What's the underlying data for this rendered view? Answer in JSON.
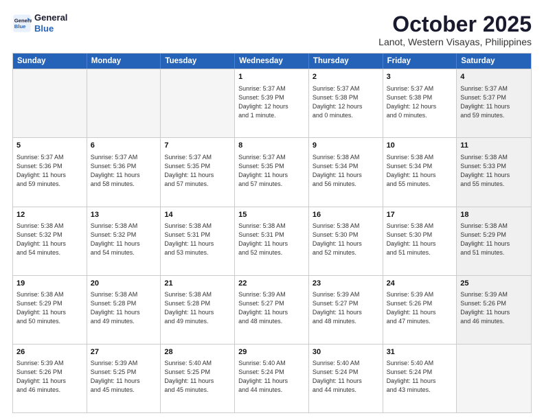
{
  "logo": {
    "line1": "General",
    "line2": "Blue"
  },
  "title": "October 2025",
  "location": "Lanot, Western Visayas, Philippines",
  "header": {
    "days": [
      "Sunday",
      "Monday",
      "Tuesday",
      "Wednesday",
      "Thursday",
      "Friday",
      "Saturday"
    ]
  },
  "weeks": [
    {
      "cells": [
        {
          "day": "",
          "content": "",
          "empty": true
        },
        {
          "day": "",
          "content": "",
          "empty": true
        },
        {
          "day": "",
          "content": "",
          "empty": true
        },
        {
          "day": "1",
          "content": "Sunrise: 5:37 AM\nSunset: 5:39 PM\nDaylight: 12 hours\nand 1 minute."
        },
        {
          "day": "2",
          "content": "Sunrise: 5:37 AM\nSunset: 5:38 PM\nDaylight: 12 hours\nand 0 minutes."
        },
        {
          "day": "3",
          "content": "Sunrise: 5:37 AM\nSunset: 5:38 PM\nDaylight: 12 hours\nand 0 minutes."
        },
        {
          "day": "4",
          "content": "Sunrise: 5:37 AM\nSunset: 5:37 PM\nDaylight: 11 hours\nand 59 minutes.",
          "shaded": true
        }
      ]
    },
    {
      "cells": [
        {
          "day": "5",
          "content": "Sunrise: 5:37 AM\nSunset: 5:36 PM\nDaylight: 11 hours\nand 59 minutes."
        },
        {
          "day": "6",
          "content": "Sunrise: 5:37 AM\nSunset: 5:36 PM\nDaylight: 11 hours\nand 58 minutes."
        },
        {
          "day": "7",
          "content": "Sunrise: 5:37 AM\nSunset: 5:35 PM\nDaylight: 11 hours\nand 57 minutes."
        },
        {
          "day": "8",
          "content": "Sunrise: 5:37 AM\nSunset: 5:35 PM\nDaylight: 11 hours\nand 57 minutes."
        },
        {
          "day": "9",
          "content": "Sunrise: 5:38 AM\nSunset: 5:34 PM\nDaylight: 11 hours\nand 56 minutes."
        },
        {
          "day": "10",
          "content": "Sunrise: 5:38 AM\nSunset: 5:34 PM\nDaylight: 11 hours\nand 55 minutes."
        },
        {
          "day": "11",
          "content": "Sunrise: 5:38 AM\nSunset: 5:33 PM\nDaylight: 11 hours\nand 55 minutes.",
          "shaded": true
        }
      ]
    },
    {
      "cells": [
        {
          "day": "12",
          "content": "Sunrise: 5:38 AM\nSunset: 5:32 PM\nDaylight: 11 hours\nand 54 minutes."
        },
        {
          "day": "13",
          "content": "Sunrise: 5:38 AM\nSunset: 5:32 PM\nDaylight: 11 hours\nand 54 minutes."
        },
        {
          "day": "14",
          "content": "Sunrise: 5:38 AM\nSunset: 5:31 PM\nDaylight: 11 hours\nand 53 minutes."
        },
        {
          "day": "15",
          "content": "Sunrise: 5:38 AM\nSunset: 5:31 PM\nDaylight: 11 hours\nand 52 minutes."
        },
        {
          "day": "16",
          "content": "Sunrise: 5:38 AM\nSunset: 5:30 PM\nDaylight: 11 hours\nand 52 minutes."
        },
        {
          "day": "17",
          "content": "Sunrise: 5:38 AM\nSunset: 5:30 PM\nDaylight: 11 hours\nand 51 minutes."
        },
        {
          "day": "18",
          "content": "Sunrise: 5:38 AM\nSunset: 5:29 PM\nDaylight: 11 hours\nand 51 minutes.",
          "shaded": true
        }
      ]
    },
    {
      "cells": [
        {
          "day": "19",
          "content": "Sunrise: 5:38 AM\nSunset: 5:29 PM\nDaylight: 11 hours\nand 50 minutes."
        },
        {
          "day": "20",
          "content": "Sunrise: 5:38 AM\nSunset: 5:28 PM\nDaylight: 11 hours\nand 49 minutes."
        },
        {
          "day": "21",
          "content": "Sunrise: 5:38 AM\nSunset: 5:28 PM\nDaylight: 11 hours\nand 49 minutes."
        },
        {
          "day": "22",
          "content": "Sunrise: 5:39 AM\nSunset: 5:27 PM\nDaylight: 11 hours\nand 48 minutes."
        },
        {
          "day": "23",
          "content": "Sunrise: 5:39 AM\nSunset: 5:27 PM\nDaylight: 11 hours\nand 48 minutes."
        },
        {
          "day": "24",
          "content": "Sunrise: 5:39 AM\nSunset: 5:26 PM\nDaylight: 11 hours\nand 47 minutes."
        },
        {
          "day": "25",
          "content": "Sunrise: 5:39 AM\nSunset: 5:26 PM\nDaylight: 11 hours\nand 46 minutes.",
          "shaded": true
        }
      ]
    },
    {
      "cells": [
        {
          "day": "26",
          "content": "Sunrise: 5:39 AM\nSunset: 5:26 PM\nDaylight: 11 hours\nand 46 minutes."
        },
        {
          "day": "27",
          "content": "Sunrise: 5:39 AM\nSunset: 5:25 PM\nDaylight: 11 hours\nand 45 minutes."
        },
        {
          "day": "28",
          "content": "Sunrise: 5:40 AM\nSunset: 5:25 PM\nDaylight: 11 hours\nand 45 minutes."
        },
        {
          "day": "29",
          "content": "Sunrise: 5:40 AM\nSunset: 5:24 PM\nDaylight: 11 hours\nand 44 minutes."
        },
        {
          "day": "30",
          "content": "Sunrise: 5:40 AM\nSunset: 5:24 PM\nDaylight: 11 hours\nand 44 minutes."
        },
        {
          "day": "31",
          "content": "Sunrise: 5:40 AM\nSunset: 5:24 PM\nDaylight: 11 hours\nand 43 minutes."
        },
        {
          "day": "",
          "content": "",
          "empty": true,
          "shaded": true
        }
      ]
    }
  ]
}
